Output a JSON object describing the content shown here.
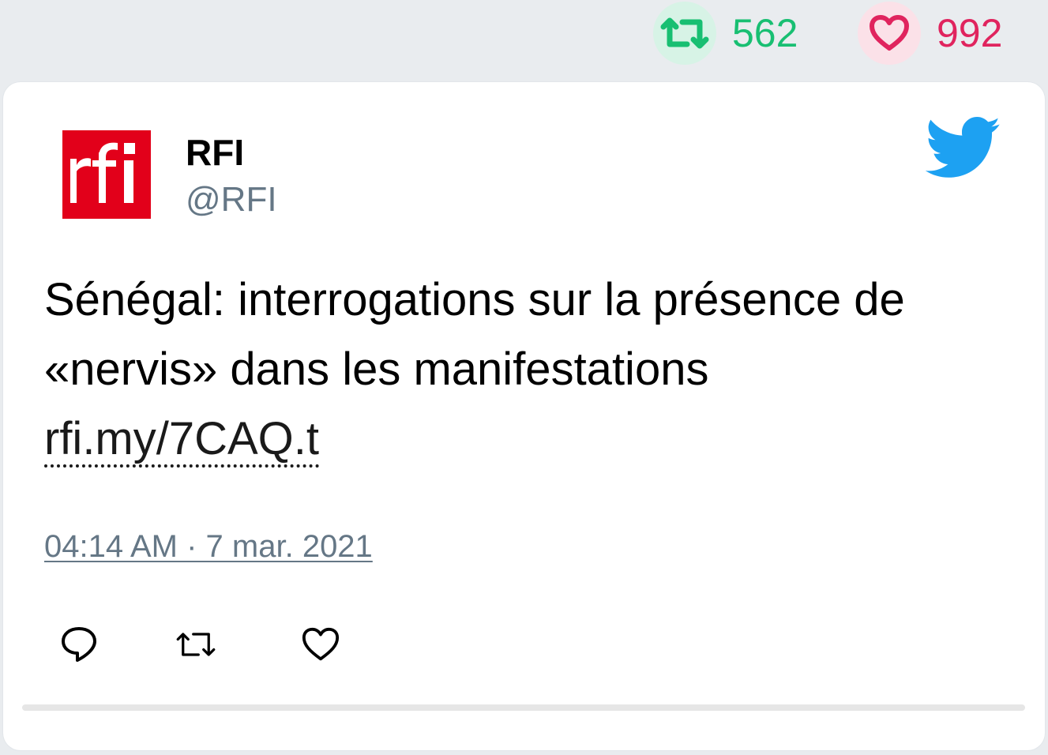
{
  "stats": {
    "retweets": "562",
    "likes": "992",
    "retweet_icon": "retweet-icon",
    "like_icon": "heart-icon",
    "retweet_color": "#18bf72",
    "like_color": "#e0245e"
  },
  "tweet": {
    "author": {
      "name": "RFI",
      "handle": "@RFI",
      "avatar_logo": "rfi"
    },
    "text": "Sénégal: interrogations sur la présence de «nervis» dans les manifestations",
    "link": "rfi.my/7CAQ.t",
    "timestamp": "04:14 AM · 7 mar. 2021",
    "brand_icon": "twitter-bird-icon",
    "brand_color": "#1da1f2",
    "actions": [
      "reply-icon",
      "retweet-icon",
      "heart-icon"
    ]
  }
}
